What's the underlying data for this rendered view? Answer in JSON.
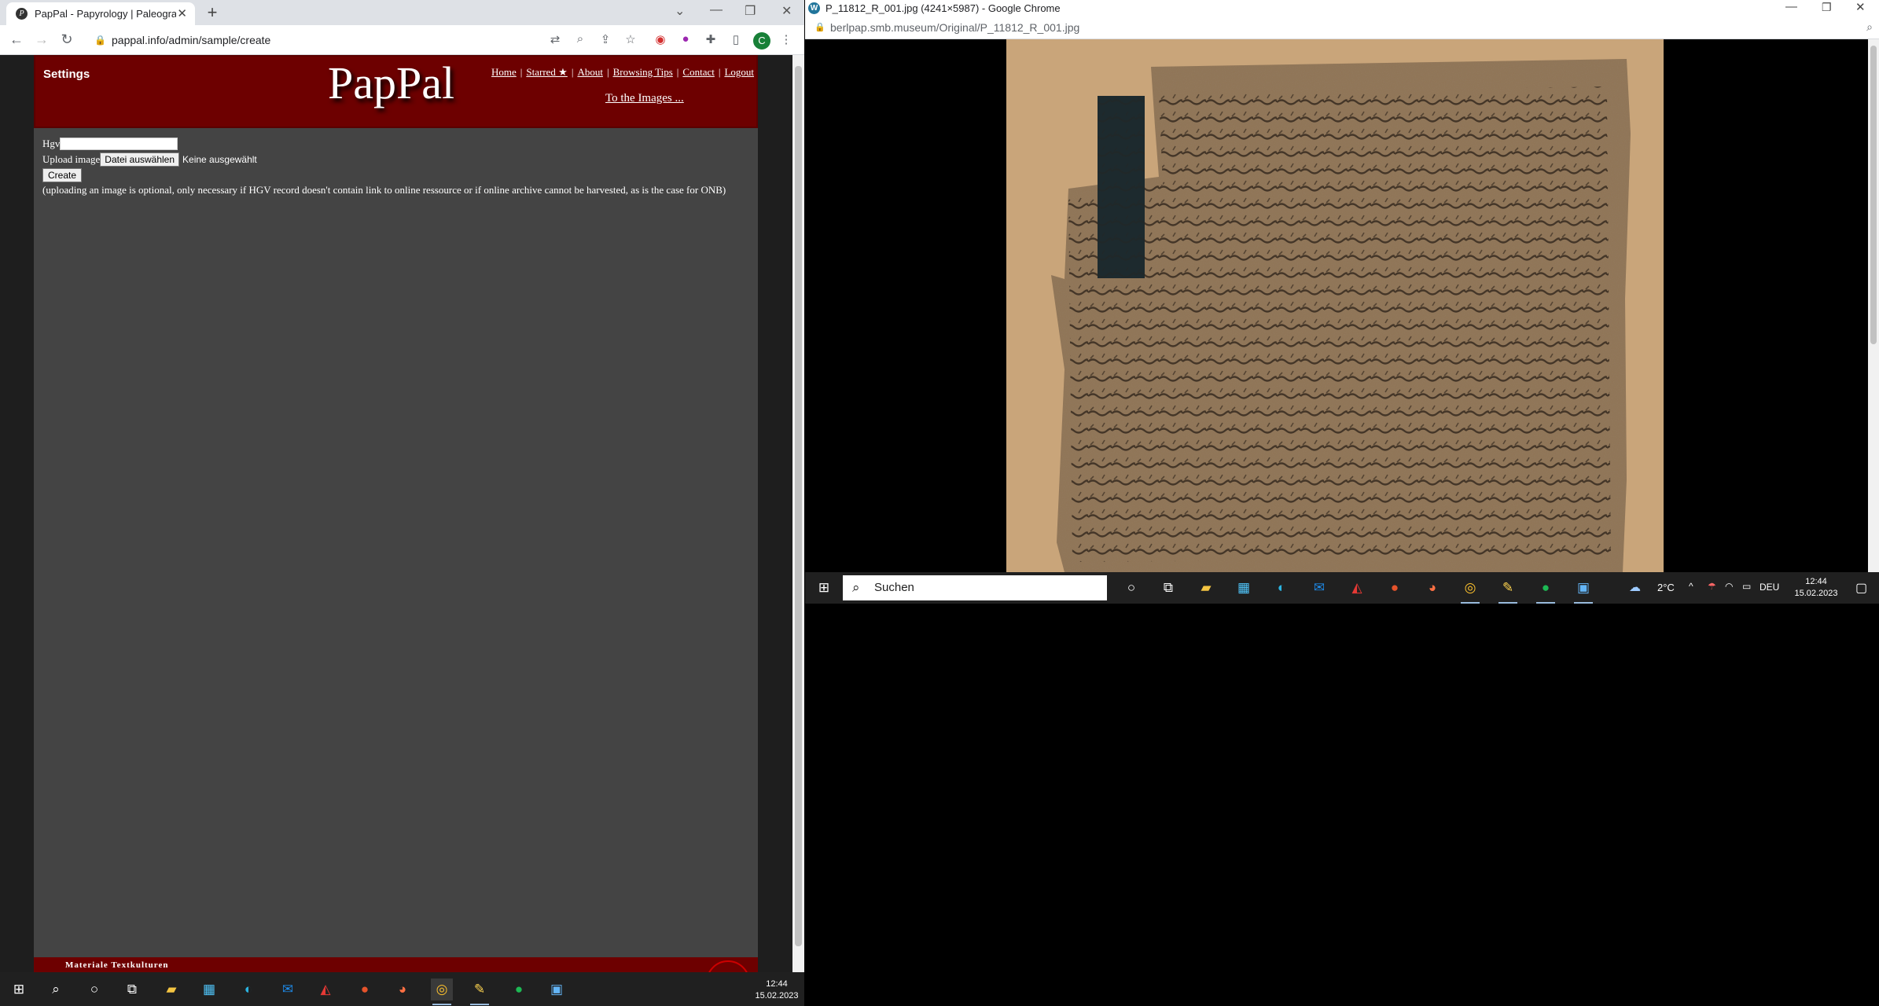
{
  "left_browser": {
    "tab_title": "PapPal - Papyrology | Paleography",
    "address": "pappal.info/admin/sample/create"
  },
  "pappal": {
    "settings_label": "Settings",
    "logo": "PapPal",
    "nav": {
      "home": "Home",
      "starred": "Starred ★",
      "about": "About",
      "browsing_tips": "Browsing Tips",
      "contact": "Contact",
      "logout": "Logout"
    },
    "to_images": "To the Images ...",
    "form": {
      "hgv_label": "Hgv",
      "hgv_value": "",
      "upload_label": "Upload image",
      "file_button": "Datei auswählen",
      "no_file": "Keine ausgewählt",
      "create_button": "Create",
      "note": "(uploading an image is optional, only necessary if HGV record doesn't contain link to online ressource or if online archive cannot be harvested, as is the case for ONB)"
    },
    "footer_text": "Materiale Textkulturen"
  },
  "right_browser": {
    "window_title": "P_11812_R_001.jpg (4241×5987) - Google Chrome",
    "address": "berlpap.smb.museum/Original/P_11812_R_001.jpg"
  },
  "right_taskbar": {
    "search_placeholder": "Suchen",
    "weather": "2°C",
    "language": "DEU",
    "time": "12:44",
    "date": "15.02.2023"
  },
  "bottom_taskbar": {
    "time": "12:44",
    "date": "15.02.2023"
  }
}
